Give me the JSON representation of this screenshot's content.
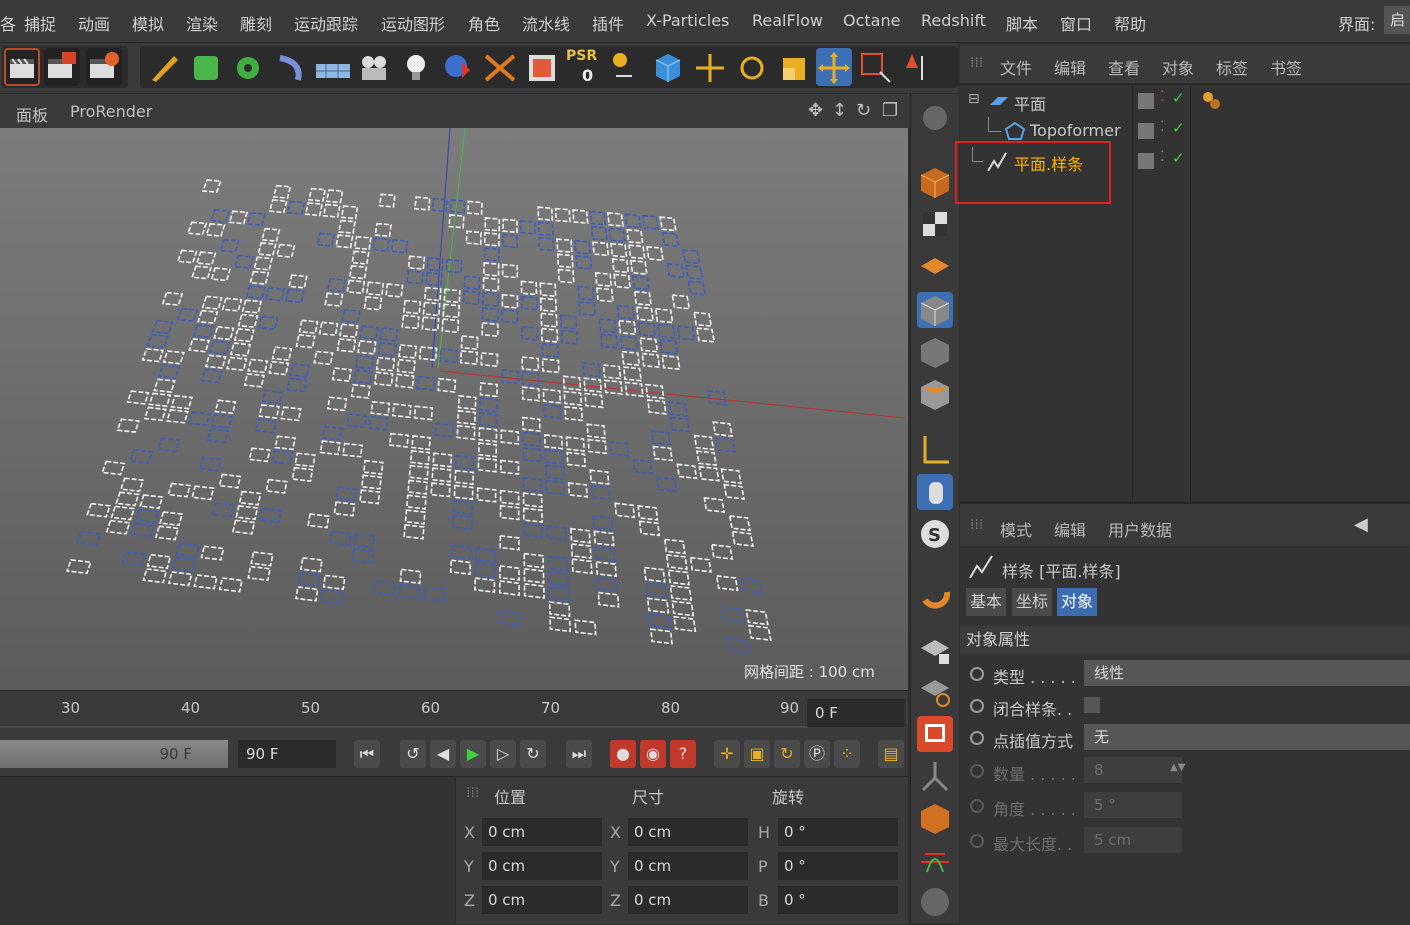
{
  "menubar": {
    "items": [
      "捕捉",
      "动画",
      "模拟",
      "渲染",
      "雕刻",
      "运动跟踪",
      "运动图形",
      "角色",
      "流水线",
      "插件",
      "X-Particles",
      "RealFlow",
      "Octane",
      "Redshift",
      "脚本",
      "窗口",
      "帮助"
    ],
    "layout_label": "界面:",
    "layout_value": "启"
  },
  "toolbar": {
    "psr_label": "PSR",
    "psr_value": "0"
  },
  "viewport": {
    "menus": [
      "面板",
      "ProRender"
    ],
    "grid_spacing": "网格间距 : 100 cm"
  },
  "timeline": {
    "ticks": [
      "30",
      "40",
      "50",
      "60",
      "70",
      "80",
      "90"
    ],
    "current_frame": "0 F"
  },
  "transport": {
    "slider_end": "90 F",
    "end_frame": "90 F"
  },
  "coordinates": {
    "headers": [
      "位置",
      "尺寸",
      "旋转"
    ],
    "rows": [
      {
        "pos_axis": "X",
        "pos": "0 cm",
        "size_axis": "X",
        "size": "0 cm",
        "rot_axis": "H",
        "rot": "0 °"
      },
      {
        "pos_axis": "Y",
        "pos": "0 cm",
        "size_axis": "Y",
        "size": "0 cm",
        "rot_axis": "P",
        "rot": "0 °"
      },
      {
        "pos_axis": "Z",
        "pos": "0 cm",
        "size_axis": "Z",
        "size": "0 cm",
        "rot_axis": "B",
        "rot": "0 °"
      }
    ]
  },
  "object_manager": {
    "menus": [
      "文件",
      "编辑",
      "查看",
      "对象",
      "标签",
      "书签"
    ],
    "objects": [
      {
        "name": "平面",
        "color": "#c8c8c8"
      },
      {
        "name": "Topoformer",
        "color": "#c8c8c8"
      },
      {
        "name": "平面.样条",
        "color": "#ffb300"
      }
    ]
  },
  "attribute_manager": {
    "menus": [
      "模式",
      "编辑",
      "用户数据"
    ],
    "object_title": "样条 [平面.样条]",
    "tabs": [
      "基本",
      "坐标",
      "对象"
    ],
    "active_tab": "对象",
    "section_title": "对象属性",
    "properties": [
      {
        "label": "类型 . . . . .",
        "value": "线性",
        "enabled": true
      },
      {
        "label": "闭合样条. .",
        "value": "",
        "enabled": true
      },
      {
        "label": "点插值方式",
        "value": "无",
        "enabled": true
      },
      {
        "label": "数量 . . . . .",
        "value": "8",
        "enabled": false
      },
      {
        "label": "角度 . . . . .",
        "value": "5 °",
        "enabled": false
      },
      {
        "label": "最大长度. .",
        "value": "5 cm",
        "enabled": false
      }
    ]
  },
  "colors": {
    "accent_blue": "#3c6bb0",
    "selected_object": "#ffb300",
    "highlight_box": "#e02020"
  }
}
